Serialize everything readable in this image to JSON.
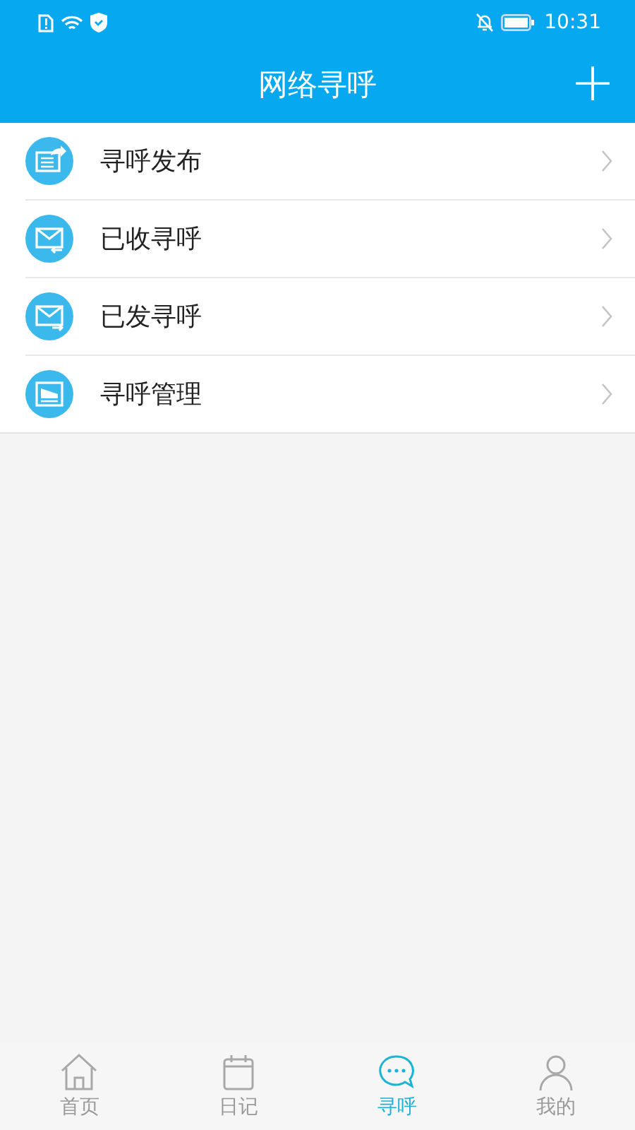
{
  "status_bar": {
    "time": "10:31"
  },
  "header": {
    "title": "网络寻呼",
    "action": "+"
  },
  "menu": [
    {
      "label": "寻呼发布",
      "kind": "publish"
    },
    {
      "label": "已收寻呼",
      "kind": "inbox"
    },
    {
      "label": "已发寻呼",
      "kind": "outbox"
    },
    {
      "label": "寻呼管理",
      "kind": "manage"
    }
  ],
  "tabs": [
    {
      "label": "首页",
      "kind": "home",
      "selected": false
    },
    {
      "label": "日记",
      "kind": "diary",
      "selected": false
    },
    {
      "label": "寻呼",
      "kind": "chat",
      "selected": true
    },
    {
      "label": "我的",
      "kind": "me",
      "selected": false
    }
  ]
}
